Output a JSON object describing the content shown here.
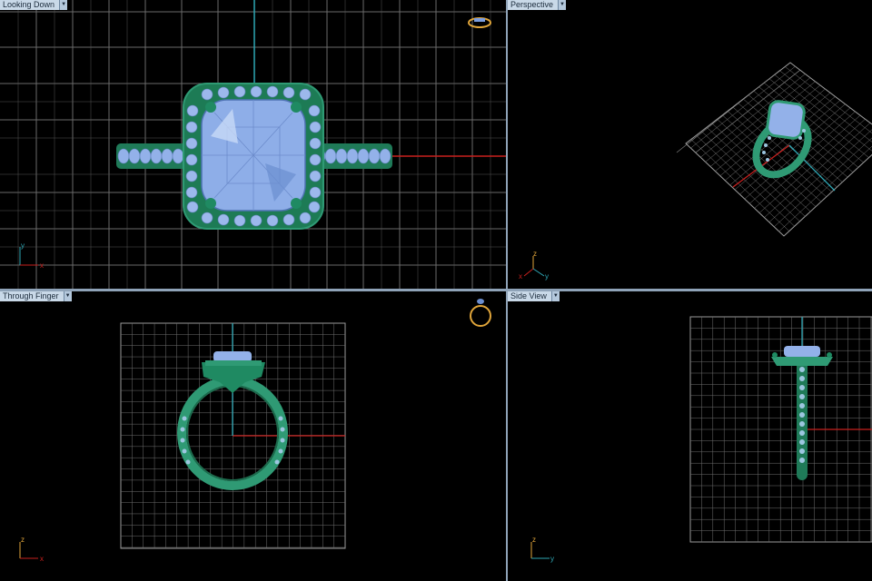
{
  "viewports": {
    "top_left": {
      "label": "Looking Down",
      "axis_a": "y",
      "axis_b": "x"
    },
    "top_right": {
      "label": "Perspective",
      "axis_a": "z",
      "axis_b": "x",
      "axis_c": "y"
    },
    "bottom_left": {
      "label": "Through Finger",
      "axis_a": "z",
      "axis_b": "x"
    },
    "bottom_right": {
      "label": "Side View",
      "axis_a": "z",
      "axis_b": "y"
    }
  },
  "icons": {
    "dropdown": "chevron-down-icon",
    "view_cube": "ring-orientation-icon"
  },
  "colors": {
    "grid": "#7d7d7d",
    "axis_x": "#c8201e",
    "axis_y": "#2ea7b5",
    "ring_metal": "#2f9a74",
    "gemstone": "#93b1e9",
    "label_bg": "#c9d9e8",
    "divider": "#8fa3b8",
    "gizmo_gold": "#e0a53a"
  }
}
